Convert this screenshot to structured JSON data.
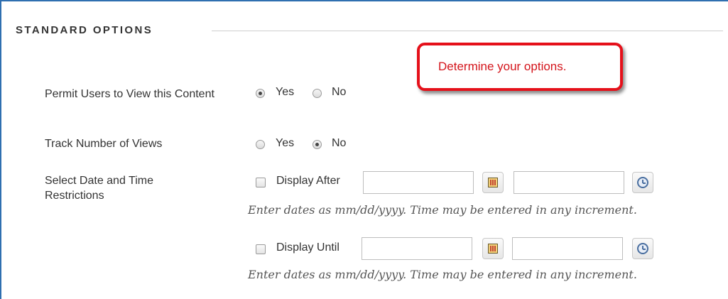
{
  "section": {
    "title": "STANDARD OPTIONS"
  },
  "callout": {
    "text": "Determine your options."
  },
  "permit_view": {
    "label": "Permit Users to View this Content",
    "yes_label": "Yes",
    "no_label": "No",
    "selected": "Yes"
  },
  "track_views": {
    "label": "Track Number of Views",
    "yes_label": "Yes",
    "no_label": "No",
    "selected": "No"
  },
  "date_restrictions": {
    "label": "Select Date and Time Restrictions",
    "display_after": {
      "checkbox_label": "Display After",
      "date_value": "",
      "time_value": "",
      "hint": "Enter dates as mm/dd/yyyy. Time may be entered in any increment."
    },
    "display_until": {
      "checkbox_label": "Display Until",
      "date_value": "",
      "time_value": "",
      "hint": "Enter dates as mm/dd/yyyy. Time may be entered in any increment."
    }
  },
  "icons": {
    "calendar": "calendar-icon",
    "clock": "clock-icon"
  },
  "colors": {
    "callout_border": "#e5101a",
    "callout_text": "#d4141b",
    "frame_border": "#2f6fb0"
  }
}
